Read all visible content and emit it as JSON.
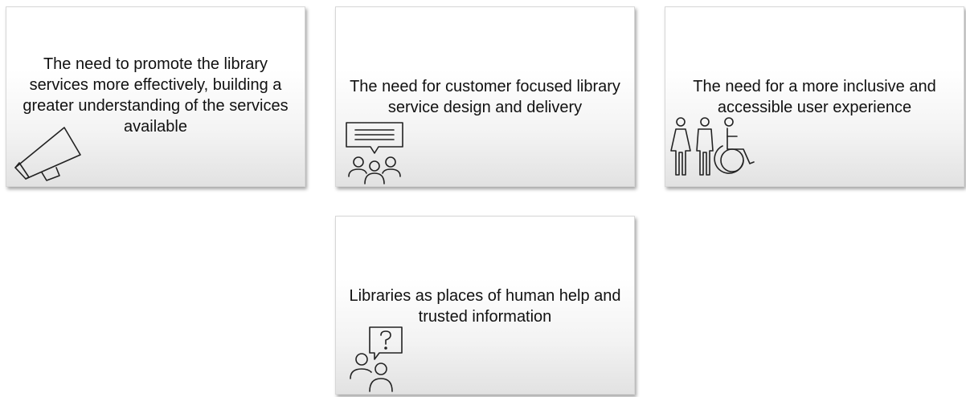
{
  "cards": [
    {
      "text": "The need to promote the library services more effectively, building a greater understanding of the services available",
      "icon": "megaphone-icon"
    },
    {
      "text": "The need for customer focused library service design and delivery",
      "icon": "group-discussion-icon"
    },
    {
      "text": "The need for a more inclusive and accessible user experience",
      "icon": "accessibility-people-icon"
    },
    {
      "text": "Libraries as places of human help and trusted information",
      "icon": "help-question-icon"
    }
  ],
  "colors": {
    "text": "#111111",
    "icon_stroke": "#222222",
    "card_top": "#ffffff",
    "card_bottom": "#e2e2e2"
  }
}
